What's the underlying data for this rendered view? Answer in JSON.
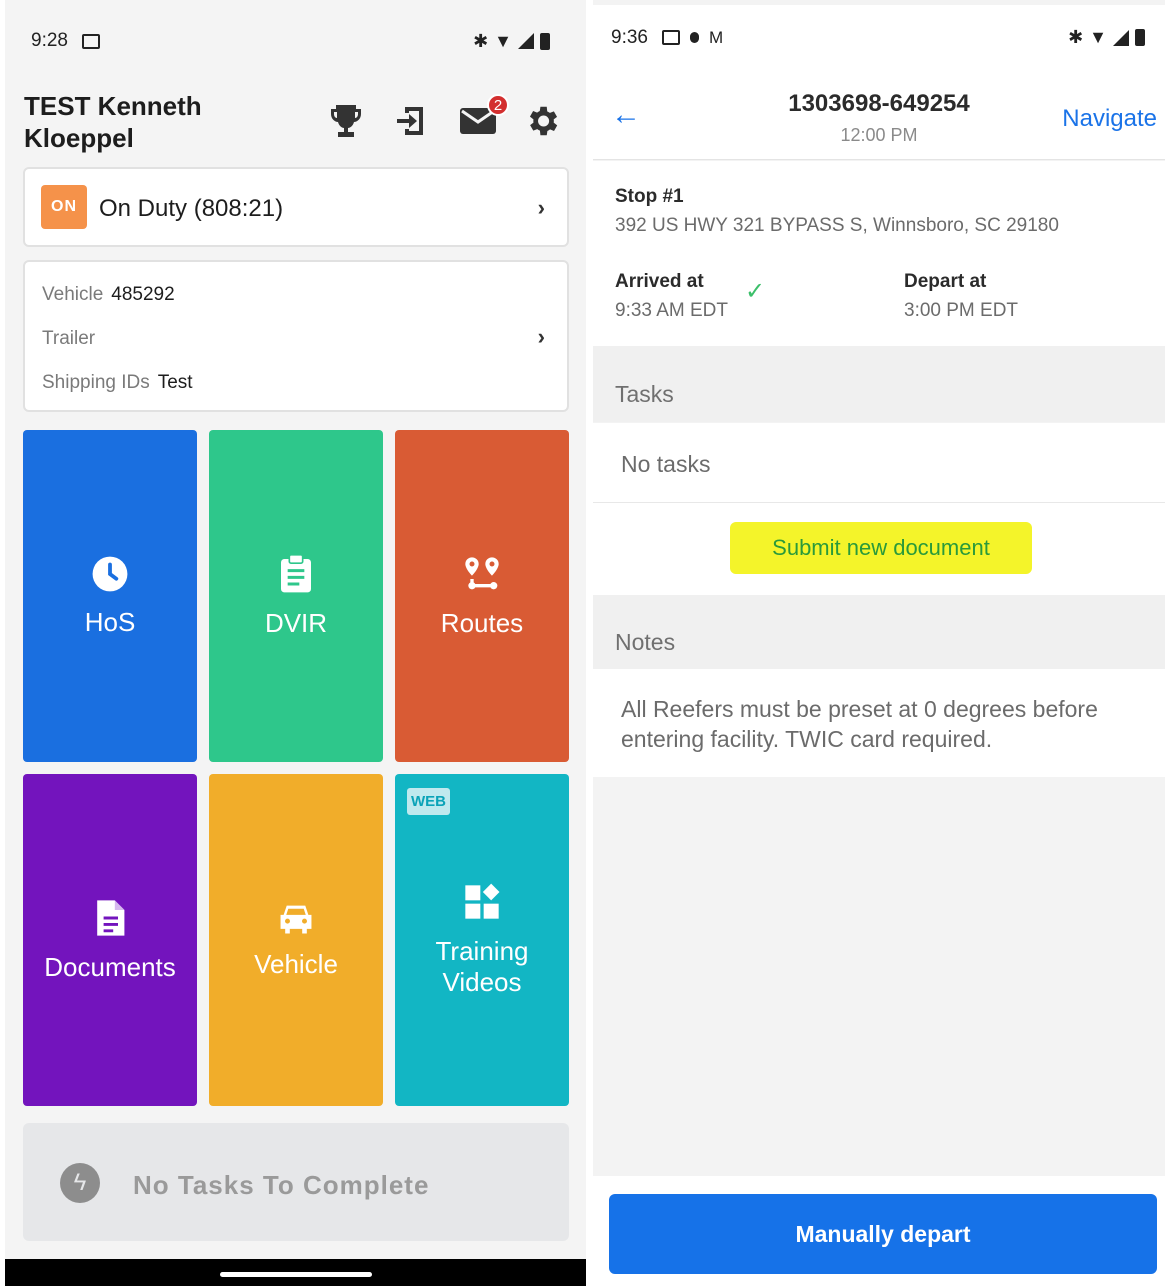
{
  "left": {
    "status": {
      "time": "9:28"
    },
    "driver_name": "TEST  Kenneth Kloeppel",
    "mail_badge": "2",
    "duty": {
      "badge": "ON",
      "text": "On Duty (808:21)"
    },
    "vehicle_card": {
      "vehicle_label": "Vehicle",
      "vehicle_value": "485292",
      "trailer_label": "Trailer",
      "shipping_label": "Shipping IDs",
      "shipping_value": "Test"
    },
    "tiles": [
      {
        "label": "HoS",
        "icon": "clock-icon",
        "color": "#1a6fe0"
      },
      {
        "label": "DVIR",
        "icon": "clipboard-icon",
        "color": "#2ec78b"
      },
      {
        "label": "Routes",
        "icon": "route-icon",
        "color": "#d95b34"
      },
      {
        "label": "Documents",
        "icon": "document-icon",
        "color": "#7314bd"
      },
      {
        "label": "Vehicle",
        "icon": "car-icon",
        "color": "#f1ad2a"
      },
      {
        "label": "Training Videos",
        "icon": "widgets-icon",
        "color": "#12b6c4",
        "tag": "WEB"
      }
    ],
    "tasks_text": "No Tasks To Complete"
  },
  "right": {
    "status": {
      "time": "9:36"
    },
    "order_number": "1303698-649254",
    "order_time": "12:00 PM",
    "navigate_label": "Navigate",
    "stop_title": "Stop #1",
    "stop_address": "392 US HWY 321 BYPASS S, Winnsboro, SC 29180",
    "arrived_label": "Arrived at",
    "arrived_time": "9:33 AM EDT",
    "depart_label": "Depart at",
    "depart_time": "3:00 PM EDT",
    "tasks_header": "Tasks",
    "no_tasks": "No tasks",
    "submit_doc": "Submit new document",
    "notes_header": "Notes",
    "notes_text": "All Reefers must be preset at 0 degrees before entering facility.   TWIC card required.",
    "depart_button": "Manually depart"
  }
}
